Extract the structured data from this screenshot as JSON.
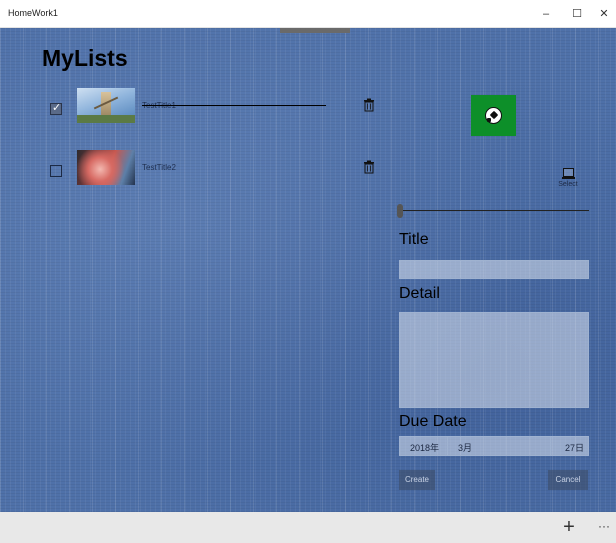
{
  "window": {
    "title": "HomeWork1",
    "minimize": "–",
    "maximize": "☐",
    "close": "✕"
  },
  "page": {
    "title": "MyLists"
  },
  "list": {
    "items": [
      {
        "title": "TestTitle1",
        "completed": true,
        "thumbnail": "sky-tower-image",
        "check_glyph": "✓"
      },
      {
        "title": "TestTitle2",
        "completed": false,
        "thumbnail": "red-tree-image"
      }
    ],
    "delete_icon": "trash-icon"
  },
  "form": {
    "image_icon": "soccer-ball-image",
    "select_label": "Select",
    "slider_value": 0,
    "title_label": "Title",
    "title_value": "",
    "detail_label": "Detail",
    "detail_value": "",
    "due_date_label": "Due Date",
    "due_date": {
      "year": "2018年",
      "month": "3月",
      "day": "27日"
    },
    "create_label": "Create",
    "cancel_label": "Cancel"
  },
  "command_bar": {
    "add": "+",
    "more": "···"
  },
  "colors": {
    "background": "#4f71a9",
    "image_preview": "#0d8f29",
    "command_bar": "#e8e8e8"
  }
}
